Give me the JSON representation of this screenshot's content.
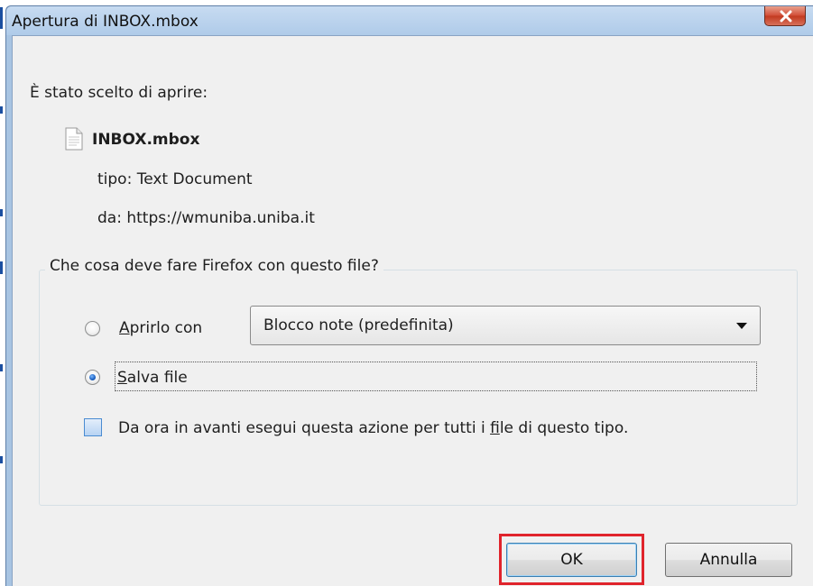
{
  "window": {
    "title": "Apertura di INBOX.mbox",
    "close_icon": "close-icon"
  },
  "intro_text": "È stato scelto di aprire:",
  "file": {
    "icon": "text-document-icon",
    "name": "INBOX.mbox",
    "type_line": "tipo: Text Document",
    "from_line": "da: https://wmuniba.uniba.it"
  },
  "action_group": {
    "legend": "Che cosa deve fare Firefox con questo file?",
    "open_with": {
      "label_first": "A",
      "label_rest": "prirlo con",
      "checked": false,
      "app_selected": "Blocco note (predefinita)"
    },
    "save_file": {
      "label_first": "S",
      "label_rest": "alva file",
      "checked": true
    },
    "remember": {
      "label_before": "Da ora in avanti esegui questa azione per tutti i ",
      "label_accel": "f",
      "label_after": "ile di questo tipo.",
      "checked": false
    }
  },
  "buttons": {
    "ok_label": "OK",
    "cancel_label": "Annulla"
  },
  "colors": {
    "titlebar": "#b4cfeb",
    "client_bg": "#f0f0f0",
    "highlight": "#e0242c",
    "close_button": "#c9452e"
  }
}
